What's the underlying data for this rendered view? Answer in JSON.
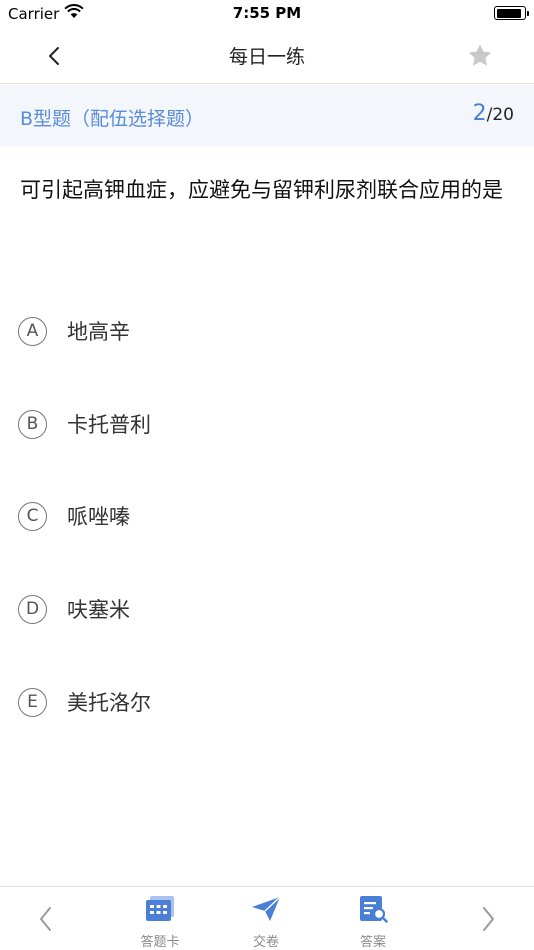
{
  "status": {
    "carrier": "Carrier",
    "time": "7:55 PM"
  },
  "nav": {
    "title": "每日一练"
  },
  "question": {
    "type_label": "B型题（配伍选择题）",
    "current": "2",
    "total": "/20",
    "text": "可引起高钾血症，应避免与留钾利尿剂联合应用的是",
    "options": [
      {
        "letter": "A",
        "text": "地高辛"
      },
      {
        "letter": "B",
        "text": "卡托普利"
      },
      {
        "letter": "C",
        "text": "哌唑嗪"
      },
      {
        "letter": "D",
        "text": "呋塞米"
      },
      {
        "letter": "E",
        "text": "美托洛尔"
      }
    ]
  },
  "bottom": {
    "answer_card": "答题卡",
    "submit": "交卷",
    "answer": "答案"
  },
  "colors": {
    "accent": "#4a7fd6",
    "type_bg": "#f3f6fb",
    "icon_blue": "#4a7fd6"
  }
}
